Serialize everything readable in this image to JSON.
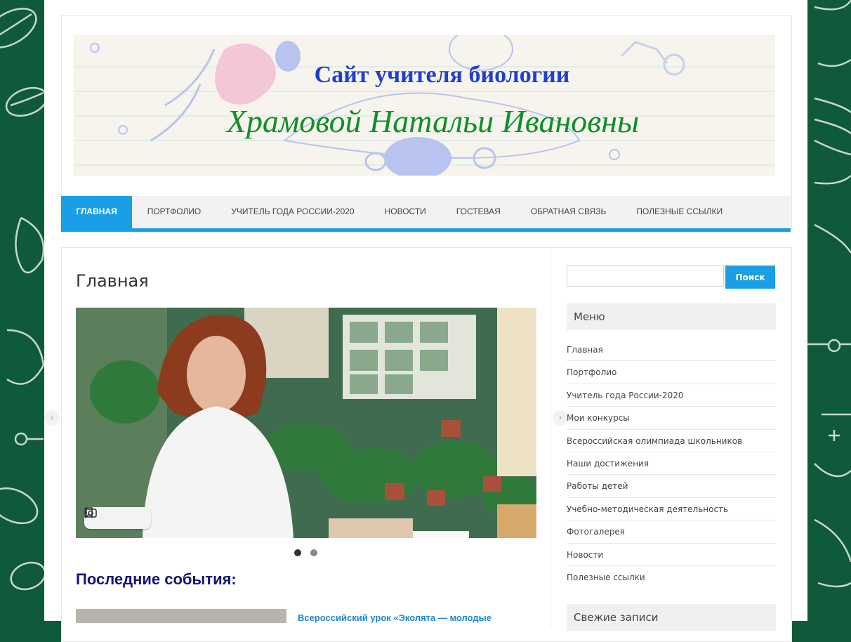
{
  "colors": {
    "accent": "#1a9fe6",
    "background_green": "#0f5a3a",
    "title_blue": "#1f3fcf",
    "title_green": "#0e8f2a",
    "section_title": "#111577"
  },
  "header": {
    "title": "Сайт учителя биологии",
    "subtitle": "Храмовой Натальи Ивановны"
  },
  "nav": {
    "items": [
      {
        "label": "Главная",
        "active": true
      },
      {
        "label": "Портфолио"
      },
      {
        "label": "Учитель года России-2020"
      },
      {
        "label": "Новости"
      },
      {
        "label": "Гостевая"
      },
      {
        "label": "Обратная связь"
      },
      {
        "label": "Полезные ссылки"
      }
    ]
  },
  "main": {
    "page_title": "Главная",
    "slider": {
      "image_desc_icon": "teacher-photo",
      "tools": [
        "bookmark-icon",
        "camera-search-icon",
        "more-vert-icon"
      ],
      "prev_icon": "chevron-left-icon",
      "next_icon": "chevron-right-icon",
      "active_slide": 1,
      "total_slides": 2
    },
    "section_title": "Последние события:",
    "news_item_title": "Всероссийский урок «Эколята — молодые"
  },
  "sidebar": {
    "search": {
      "placeholder": "",
      "button_label": "Поиск"
    },
    "menu_title": "Меню",
    "menu_items": [
      "Главная",
      "Портфолио",
      "Учитель года России-2020",
      "Мои конкурсы",
      "Всероссийская олимпиада школьников",
      "Наши достижения",
      "Работы детей",
      "Учебно-методическая деятельность",
      "Фотогалерея",
      "Новости",
      "Полезные ссылки"
    ],
    "recent_title": "Свежие записи"
  }
}
